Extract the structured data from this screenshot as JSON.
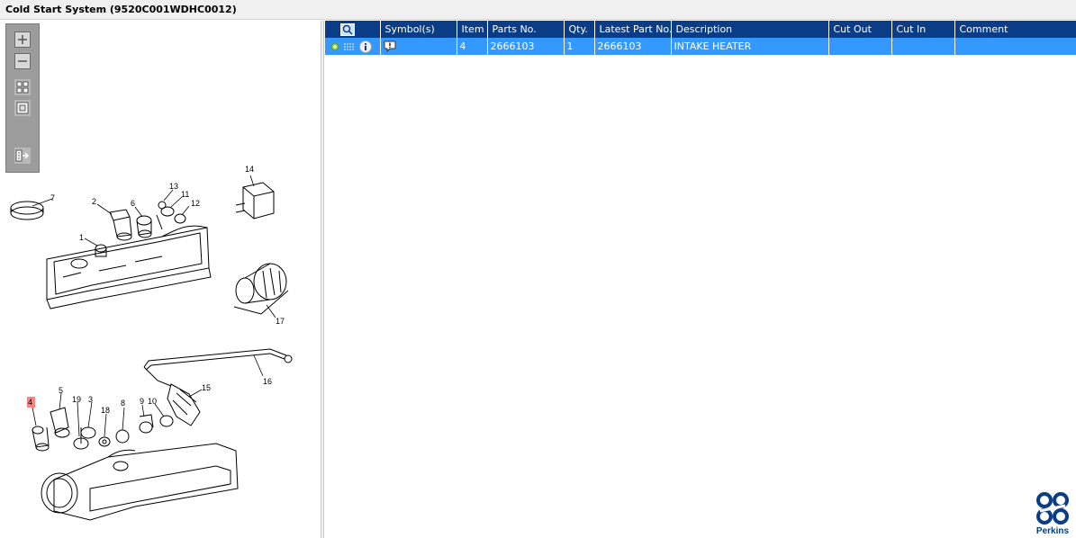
{
  "window": {
    "title": "Cold Start System (9520C001WDHC0012)"
  },
  "zoom_toolbar": {
    "icons": [
      "zoom-in-icon",
      "zoom-out-icon",
      "fit-all-icon",
      "fit-window-icon",
      "export-icon"
    ]
  },
  "diagram": {
    "callouts": [
      "1",
      "2",
      "3",
      "4",
      "5",
      "6",
      "7",
      "8",
      "9",
      "10",
      "11",
      "12",
      "13",
      "14",
      "15",
      "16",
      "17",
      "18",
      "19"
    ],
    "highlighted_callout": "4",
    "highlight_color": "#ff8080"
  },
  "table": {
    "columns": [
      "Symbol(s)",
      "Item",
      "Parts No.",
      "Qty.",
      "Latest Part No.",
      "Description",
      "Cut Out",
      "Cut In",
      "Comment"
    ],
    "header_icon": "search-parts-icon",
    "rows": [
      {
        "icons": [
          "green-dot-icon",
          "list-icon",
          "info-icon"
        ],
        "symbol_icon": "speech-bubble-icon",
        "item": "4",
        "part_no": "2666103",
        "qty": "1",
        "latest_part_no": "2666103",
        "description": "INTAKE HEATER",
        "cut_out": "",
        "cut_in": "",
        "comment": ""
      }
    ]
  },
  "colors": {
    "header_bg": "#0a3d85",
    "selected_row_bg": "#3399ff",
    "brand": "#0a3d85"
  },
  "brand": {
    "name": "Perkins"
  }
}
